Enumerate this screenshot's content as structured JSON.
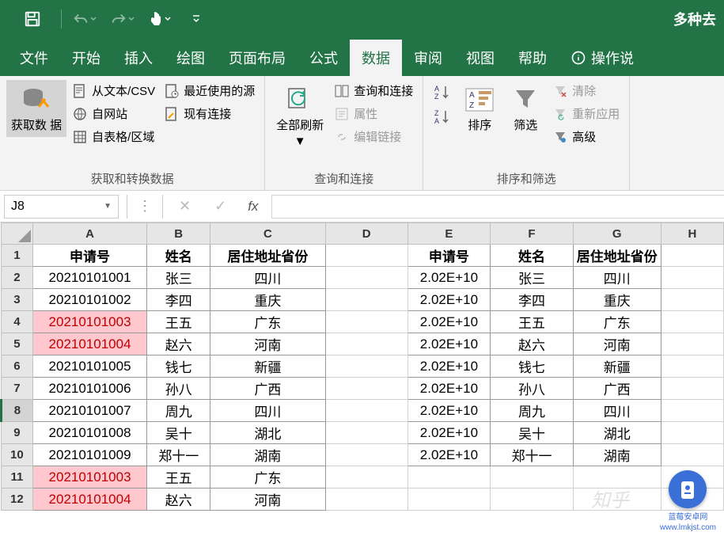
{
  "titlebar": {
    "right_text": "多种去"
  },
  "tabs": {
    "file": "文件",
    "home": "开始",
    "insert": "插入",
    "draw": "绘图",
    "layout": "页面布局",
    "formula": "公式",
    "data": "数据",
    "review": "审阅",
    "view": "视图",
    "help": "帮助",
    "tellme": "操作说"
  },
  "ribbon": {
    "group1_label": "获取和转换数据",
    "getdata": "获取数\n据",
    "fromtext": "从文本/CSV",
    "fromweb": "自网站",
    "fromtable": "自表格/区域",
    "recent": "最近使用的源",
    "existing": "现有连接",
    "group2_label": "查询和连接",
    "refreshall": "全部刷新",
    "queries": "查询和连接",
    "properties": "属性",
    "editlinks": "编辑链接",
    "group3_label": "排序和筛选",
    "sort": "排序",
    "filter": "筛选",
    "clear": "清除",
    "reapply": "重新应用",
    "advanced": "高级"
  },
  "namebox": "J8",
  "columns": [
    "A",
    "B",
    "C",
    "D",
    "E",
    "F",
    "G",
    "H"
  ],
  "headers1": {
    "a": "申请号",
    "b": "姓名",
    "c": "居住地址省份"
  },
  "headers2": {
    "e": "申请号",
    "f": "姓名",
    "g": "居住地址省份"
  },
  "rows": [
    {
      "r": 2,
      "a": "20210101001",
      "b": "张三",
      "c": "四川",
      "e": "2.02E+10",
      "f": "张三",
      "g": "四川"
    },
    {
      "r": 3,
      "a": "20210101002",
      "b": "李四",
      "c": "重庆",
      "e": "2.02E+10",
      "f": "李四",
      "g": "重庆"
    },
    {
      "r": 4,
      "a": "20210101003",
      "b": "王五",
      "c": "广东",
      "e": "2.02E+10",
      "f": "王五",
      "g": "广东",
      "red": true
    },
    {
      "r": 5,
      "a": "20210101004",
      "b": "赵六",
      "c": "河南",
      "e": "2.02E+10",
      "f": "赵六",
      "g": "河南",
      "red": true
    },
    {
      "r": 6,
      "a": "20210101005",
      "b": "钱七",
      "c": "新疆",
      "e": "2.02E+10",
      "f": "钱七",
      "g": "新疆"
    },
    {
      "r": 7,
      "a": "20210101006",
      "b": "孙八",
      "c": "广西",
      "e": "2.02E+10",
      "f": "孙八",
      "g": "广西"
    },
    {
      "r": 8,
      "a": "20210101007",
      "b": "周九",
      "c": "四川",
      "e": "2.02E+10",
      "f": "周九",
      "g": "四川",
      "active": true
    },
    {
      "r": 9,
      "a": "20210101008",
      "b": "吴十",
      "c": "湖北",
      "e": "2.02E+10",
      "f": "吴十",
      "g": "湖北"
    },
    {
      "r": 10,
      "a": "20210101009",
      "b": "郑十一",
      "c": "湖南",
      "e": "2.02E+10",
      "f": "郑十一",
      "g": "湖南"
    },
    {
      "r": 11,
      "a": "20210101003",
      "b": "王五",
      "c": "广东",
      "red": true
    },
    {
      "r": 12,
      "a": "20210101004",
      "b": "赵六",
      "c": "河南",
      "red": true
    }
  ],
  "watermark": "知乎",
  "logo": {
    "name": "蓝莓安卓网",
    "url": "www.lmkjst.com"
  }
}
